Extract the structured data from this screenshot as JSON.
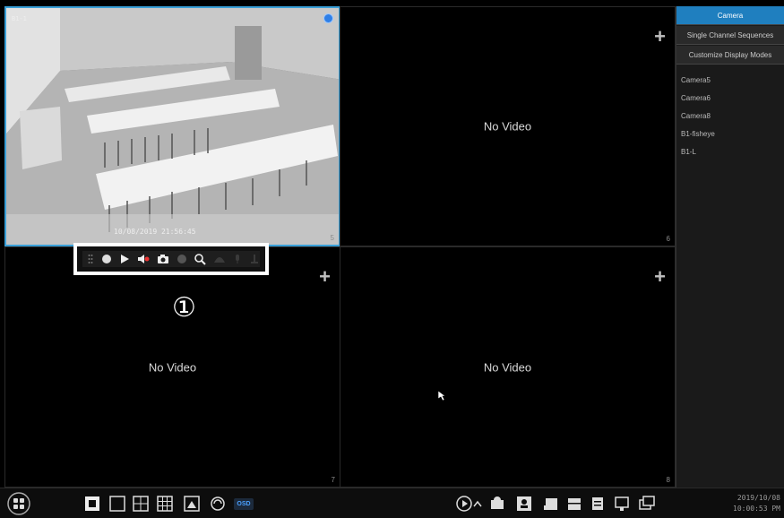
{
  "tiles": [
    {
      "id": "tile-1",
      "camera_label": "B1-1",
      "timestamp": "10/08/2019 21:56:45",
      "channel": "5",
      "no_video": ""
    },
    {
      "id": "tile-2",
      "no_video": "No Video",
      "channel": "6"
    },
    {
      "id": "tile-3",
      "no_video": "No Video",
      "channel": "7"
    },
    {
      "id": "tile-4",
      "no_video": "No Video",
      "channel": "8"
    }
  ],
  "callout": {
    "number": "①"
  },
  "panel": {
    "tabs": [
      {
        "label": "Camera",
        "active": true
      },
      {
        "label": "Single Channel Sequences",
        "active": false
      },
      {
        "label": "Customize Display Modes",
        "active": false
      }
    ],
    "cameras": [
      "Camera5",
      "Camera6",
      "Camera8",
      "B1-fisheye",
      "B1-L"
    ]
  },
  "bottombar": {
    "osd_label": "OSD",
    "date": "2019/10/08",
    "time": "10:00:53 PM"
  },
  "colors": {
    "accent": "#1f7fbf",
    "selected_border": "#3aa0d8",
    "rec_dot": "#2f7fe6"
  }
}
